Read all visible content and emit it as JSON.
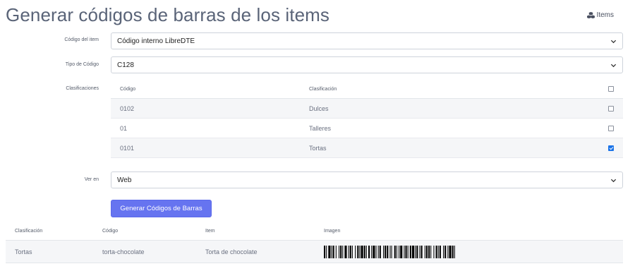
{
  "header": {
    "title": "Generar códigos de barras de los items",
    "items_link": "Items"
  },
  "form": {
    "codigo_item": {
      "label": "Código del item",
      "value": "Código interno LibreDTE"
    },
    "tipo_codigo": {
      "label": "Tipo de Código",
      "value": "C128"
    },
    "clasificaciones": {
      "label": "Clasificaciones",
      "headers": {
        "codigo": "Código",
        "clasificacion": "Clasificación"
      },
      "all_checked": false,
      "rows": [
        {
          "codigo": "0102",
          "clasificacion": "Dulces",
          "checked": false
        },
        {
          "codigo": "01",
          "clasificacion": "Talleres",
          "checked": false
        },
        {
          "codigo": "0101",
          "clasificacion": "Tortas",
          "checked": true
        }
      ]
    },
    "ver_en": {
      "label": "Ver en",
      "value": "Web"
    },
    "submit_label": "Generar Códigos de Barras"
  },
  "results": {
    "headers": {
      "clasificacion": "Clasificación",
      "codigo": "Código",
      "item": "Item",
      "imagen": "Imagen"
    },
    "rows": [
      {
        "clasificacion": "Tortas",
        "codigo": "torta-chocolate",
        "item": "Torta de chocolate"
      }
    ]
  },
  "colors": {
    "primary_button": "#6674f0",
    "checkbox_checked": "#1a73e8",
    "title": "#5a6478"
  },
  "icons": {
    "items_link": "cubes-icon",
    "select_arrow": "chevron-down-icon"
  }
}
